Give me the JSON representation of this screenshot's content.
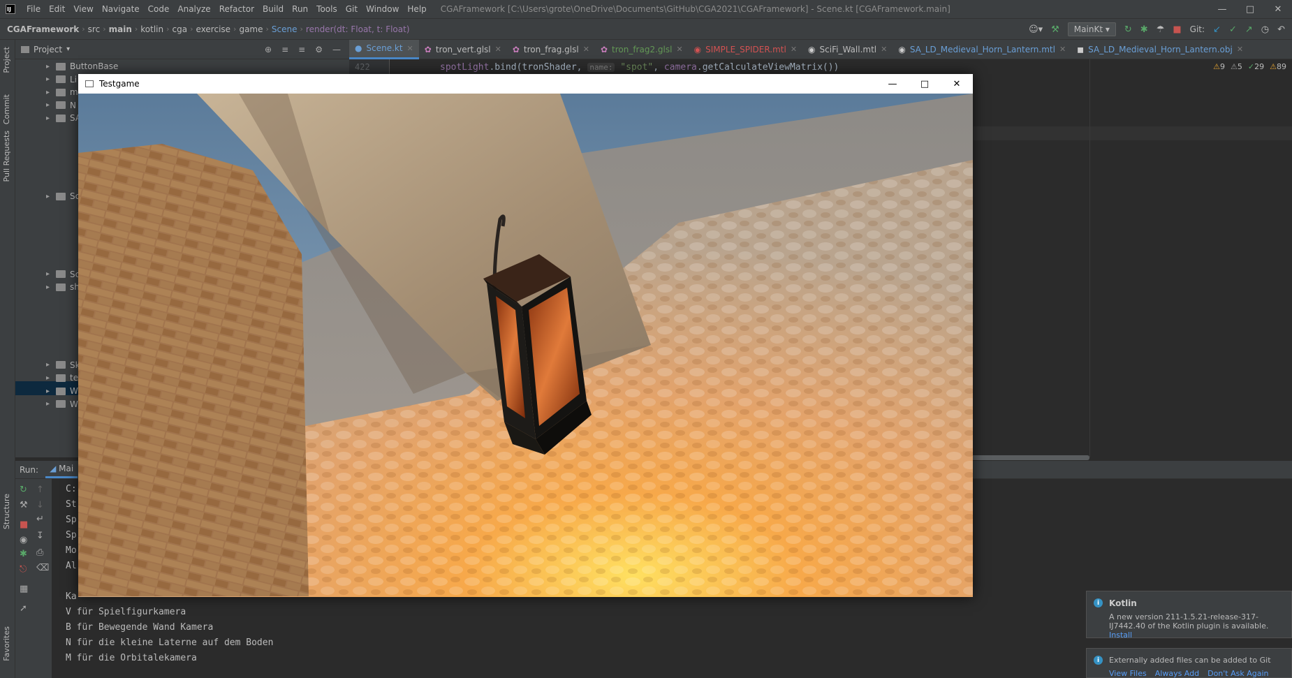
{
  "menubar": {
    "items": [
      "File",
      "Edit",
      "View",
      "Navigate",
      "Code",
      "Analyze",
      "Refactor",
      "Build",
      "Run",
      "Tools",
      "Git",
      "Window",
      "Help"
    ],
    "title": "CGAFramework [C:\\Users\\grote\\OneDrive\\Documents\\GitHub\\CGA2021\\CGAFramework] - Scene.kt [CGAFramework.main]"
  },
  "breadcrumbs": [
    "CGAFramework",
    "src",
    "main",
    "kotlin",
    "cga",
    "exercise",
    "game",
    "Scene",
    "render(dt: Float, t: Float)"
  ],
  "run_config": "MainKt",
  "git_label": "Git:",
  "project_panel": {
    "title": "Project",
    "rows": [
      "ButtonBase",
      "Li",
      "m",
      "N",
      "SA",
      "",
      "",
      "",
      "",
      "",
      "Sc",
      "",
      "",
      "",
      "",
      "",
      "Sc",
      "sh",
      "",
      "",
      "",
      "",
      "",
      "Sk",
      "te",
      "W",
      "W"
    ]
  },
  "tabs": [
    {
      "label": "Scene.kt",
      "color": "#6a9fd6"
    },
    {
      "label": "tron_vert.glsl",
      "color": "#bbbbbb"
    },
    {
      "label": "tron_frag.glsl",
      "color": "#bbbbbb"
    },
    {
      "label": "tron_frag2.glsl",
      "color": "#629755"
    },
    {
      "label": "SIMPLE_SPIDER.mtl",
      "color": "#d25252"
    },
    {
      "label": "SciFi_Wall.mtl",
      "color": "#bbbbbb"
    },
    {
      "label": "SA_LD_Medieval_Horn_Lantern.mtl",
      "color": "#6a9fd6"
    },
    {
      "label": "SA_LD_Medieval_Horn_Lantern.obj",
      "color": "#6a9fd6"
    }
  ],
  "editor": {
    "line_number": "422",
    "code_prefix": "spotLight",
    "code_call": ".bind(tronShader, ",
    "param_hint": "name:",
    "string_arg": "\"spot\"",
    "code_rest": ", ",
    "camera": "camera",
    "code_end": ".getCalculateViewMatrix())",
    "inspections": {
      "warnings": "9",
      "weak_warnings": "5",
      "typos": "29",
      "other": "89"
    }
  },
  "run_panel": {
    "label": "Run:",
    "tab": "Mai",
    "console_lines": [
      "C:",
      "St",
      "Sp",
      "Sp",
      "Mo",
      "Al",
      "",
      "Ka",
      "V für Spielfigurkamera",
      "B für Bewegende Wand Kamera",
      "N für die kleine Laterne auf dem Boden",
      "M für die Orbitalekamera"
    ]
  },
  "game_window": {
    "title": "Testgame"
  },
  "sidebar_labels": [
    "Project",
    "Commit",
    "Pull Requests",
    "Structure",
    "Favorites"
  ],
  "notifications": [
    {
      "title": "Kotlin",
      "body": "A new version 211-1.5.21-release-317-IJ7442.40 of the Kotlin plugin is available.",
      "action": "Install"
    },
    {
      "title": "",
      "body": "Externally added files can be added to Git",
      "actions": [
        "View Files",
        "Always Add",
        "Don't Ask Again"
      ]
    }
  ]
}
